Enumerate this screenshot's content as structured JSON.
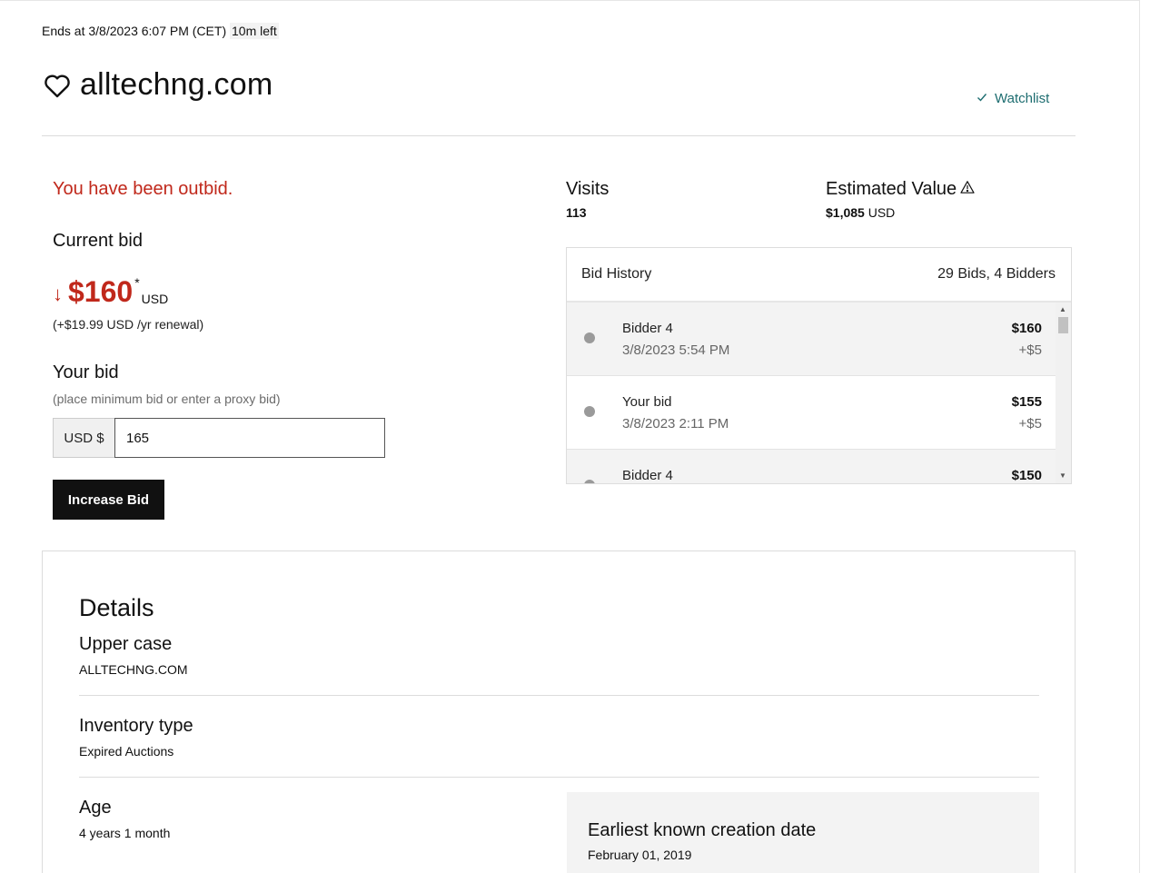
{
  "auction": {
    "ends_text": "Ends at 3/8/2023 6:07 PM (CET)",
    "time_left": "10m left"
  },
  "domain": "alltechng.com",
  "watchlist_label": "Watchlist",
  "bid": {
    "status": "You have been outbid.",
    "current_bid_label": "Current bid",
    "current_price": "$160",
    "price_marker": "*",
    "currency": "USD",
    "renewal": "(+$19.99 USD /yr renewal)",
    "your_bid_label": "Your bid",
    "your_bid_hint": "(place minimum bid or enter a proxy bid)",
    "input_prefix": "USD $",
    "input_value": "165",
    "increase_button": "Increase Bid"
  },
  "stats": {
    "visits_label": "Visits",
    "visits_value": "113",
    "estimated_label": "Estimated Value",
    "estimated_amount": "$1,085",
    "estimated_currency": "USD"
  },
  "bid_history": {
    "title": "Bid History",
    "summary": "29 Bids, 4 Bidders",
    "rows": [
      {
        "bidder": "Bidder 4",
        "date": "3/8/2023 5:54 PM",
        "amount": "$160",
        "increment": "+$5"
      },
      {
        "bidder": "Your bid",
        "date": "3/8/2023 2:11 PM",
        "amount": "$155",
        "increment": "+$5"
      },
      {
        "bidder": "Bidder 4",
        "date": "",
        "amount": "$150",
        "increment": ""
      }
    ]
  },
  "details": {
    "title": "Details",
    "upper_case_label": "Upper case",
    "upper_case_value": "ALLTECHNG.COM",
    "inventory_label": "Inventory type",
    "inventory_value": "Expired Auctions",
    "age_label": "Age",
    "age_value": "4 years 1 month",
    "creation_label": "Earliest known creation date",
    "creation_value": "February 01, 2019"
  },
  "colors": {
    "alert_red": "#c0281b",
    "link_teal": "#1d6d70",
    "button_black": "#111111"
  }
}
